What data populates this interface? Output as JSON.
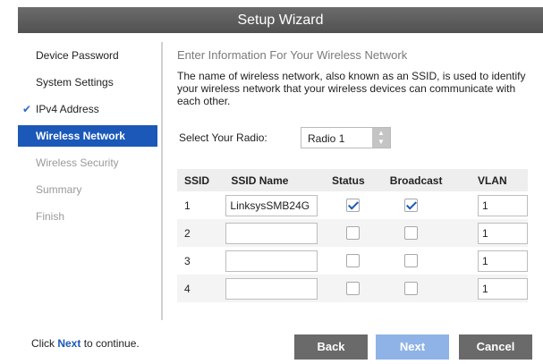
{
  "title": "Setup Wizard",
  "sidebar": {
    "items": [
      {
        "label": "Device Password",
        "state": "normal"
      },
      {
        "label": "System Settings",
        "state": "normal"
      },
      {
        "label": "IPv4 Address",
        "state": "done",
        "icon": "check-icon"
      },
      {
        "label": "Wireless Network",
        "state": "active"
      },
      {
        "label": "Wireless Security",
        "state": "disabled"
      },
      {
        "label": "Summary",
        "state": "disabled"
      },
      {
        "label": "Finish",
        "state": "disabled"
      }
    ]
  },
  "main": {
    "heading": "Enter Information For Your Wireless Network",
    "description": "The name of wireless network, also known as an SSID, is used to identify your wireless network that your wireless devices can communicate with each other.",
    "radio": {
      "label": "Select Your Radio:",
      "selected": "Radio 1"
    },
    "table": {
      "headers": [
        "SSID",
        "SSID Name",
        "Status",
        "Broadcast",
        "VLAN"
      ],
      "rows": [
        {
          "ssid": "1",
          "name": "LinksysSMB24G",
          "status": true,
          "broadcast": true,
          "vlan": "1"
        },
        {
          "ssid": "2",
          "name": "",
          "status": false,
          "broadcast": false,
          "vlan": "1"
        },
        {
          "ssid": "3",
          "name": "",
          "status": false,
          "broadcast": false,
          "vlan": "1"
        },
        {
          "ssid": "4",
          "name": "",
          "status": false,
          "broadcast": false,
          "vlan": "1"
        }
      ]
    }
  },
  "footer": {
    "prefix": "Click ",
    "link": "Next",
    "suffix": " to continue.",
    "buttons": {
      "back": "Back",
      "next": "Next",
      "cancel": "Cancel"
    }
  },
  "colors": {
    "accent": "#1b58b8",
    "titlebar": "#5e5e5e",
    "next_button": "#8fb3e6",
    "dark_button": "#6a6a6a"
  }
}
